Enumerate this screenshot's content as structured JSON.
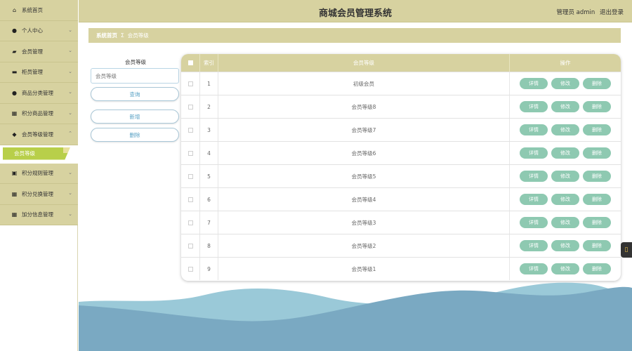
{
  "app": {
    "title": "商城会员管理系统",
    "user_label": "管理员 admin",
    "logout": "退出登录"
  },
  "sidebar": {
    "items": [
      {
        "label": "系统首页",
        "icon": "home-icon",
        "glyph": "⌂",
        "chev": ""
      },
      {
        "label": "个人中心",
        "icon": "person-icon",
        "glyph": "●",
        "chev": "⌄"
      },
      {
        "label": "会员管理",
        "icon": "card-icon",
        "glyph": "▰",
        "chev": "⌄"
      },
      {
        "label": "柜员管理",
        "icon": "monitor-icon",
        "glyph": "▬",
        "chev": "⌄"
      },
      {
        "label": "商品分类管理",
        "icon": "person-icon",
        "glyph": "●",
        "chev": "⌄"
      },
      {
        "label": "积分商品管理",
        "icon": "grid-icon",
        "glyph": "▦",
        "chev": "⌄"
      },
      {
        "label": "会员等级管理",
        "icon": "pin-icon",
        "glyph": "◆",
        "chev": "⌃"
      }
    ],
    "active_sub": "会员等级",
    "items_after": [
      {
        "label": "积分规则管理",
        "icon": "clipboard-icon",
        "glyph": "▣",
        "chev": "⌄"
      },
      {
        "label": "积分兑换管理",
        "icon": "grid-icon",
        "glyph": "▦",
        "chev": "⌄"
      },
      {
        "label": "加分信息管理",
        "icon": "grid-icon",
        "glyph": "▦",
        "chev": "⌄"
      }
    ]
  },
  "breadcrumb": {
    "home": "系统首页",
    "sep": "Σ",
    "current": "会员等级"
  },
  "search": {
    "label": "会员等级",
    "placeholder": "会员等级",
    "query_btn": "查询",
    "add_btn": "新增",
    "delete_btn": "删除"
  },
  "table": {
    "headers": {
      "index": "索引",
      "level": "会员等级",
      "ops": "操作"
    },
    "op_labels": {
      "detail": "详情",
      "edit": "修改",
      "delete": "删除"
    },
    "rows": [
      {
        "index": "1",
        "level": "初级会员"
      },
      {
        "index": "2",
        "level": "会员等级8"
      },
      {
        "index": "3",
        "level": "会员等级7"
      },
      {
        "index": "4",
        "level": "会员等级6"
      },
      {
        "index": "5",
        "level": "会员等级5"
      },
      {
        "index": "6",
        "level": "会员等级4"
      },
      {
        "index": "7",
        "level": "会员等级3"
      },
      {
        "index": "8",
        "level": "会员等级2"
      },
      {
        "index": "9",
        "level": "会员等级1"
      }
    ]
  },
  "colors": {
    "primary": "#d7d2a0",
    "accent_green": "#b8cf4a",
    "op_button": "#8ec9b1",
    "wave_light": "#9ac9d8",
    "wave_dark": "#7aa9c2"
  }
}
